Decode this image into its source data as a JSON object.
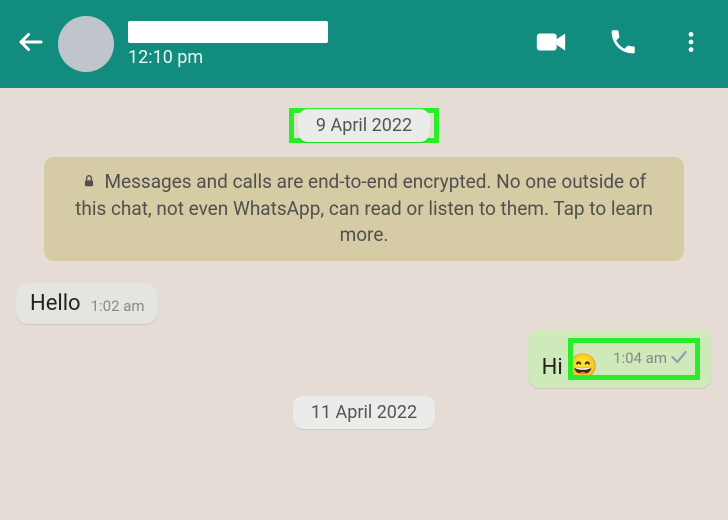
{
  "header": {
    "contact_name_redacted": true,
    "last_seen": "12:10 pm"
  },
  "dates": {
    "d1": "9 April 2022",
    "d2": "11 April 2022"
  },
  "encryption_notice": "Messages and calls are end-to-end encrypted. No one outside of this chat, not even WhatsApp, can read or listen to them. Tap to learn more.",
  "messages": {
    "m1": {
      "text": "Hello",
      "time": "1:02 am"
    },
    "m2": {
      "text": "Hi",
      "emoji": "😄",
      "time": "1:04 am"
    }
  }
}
